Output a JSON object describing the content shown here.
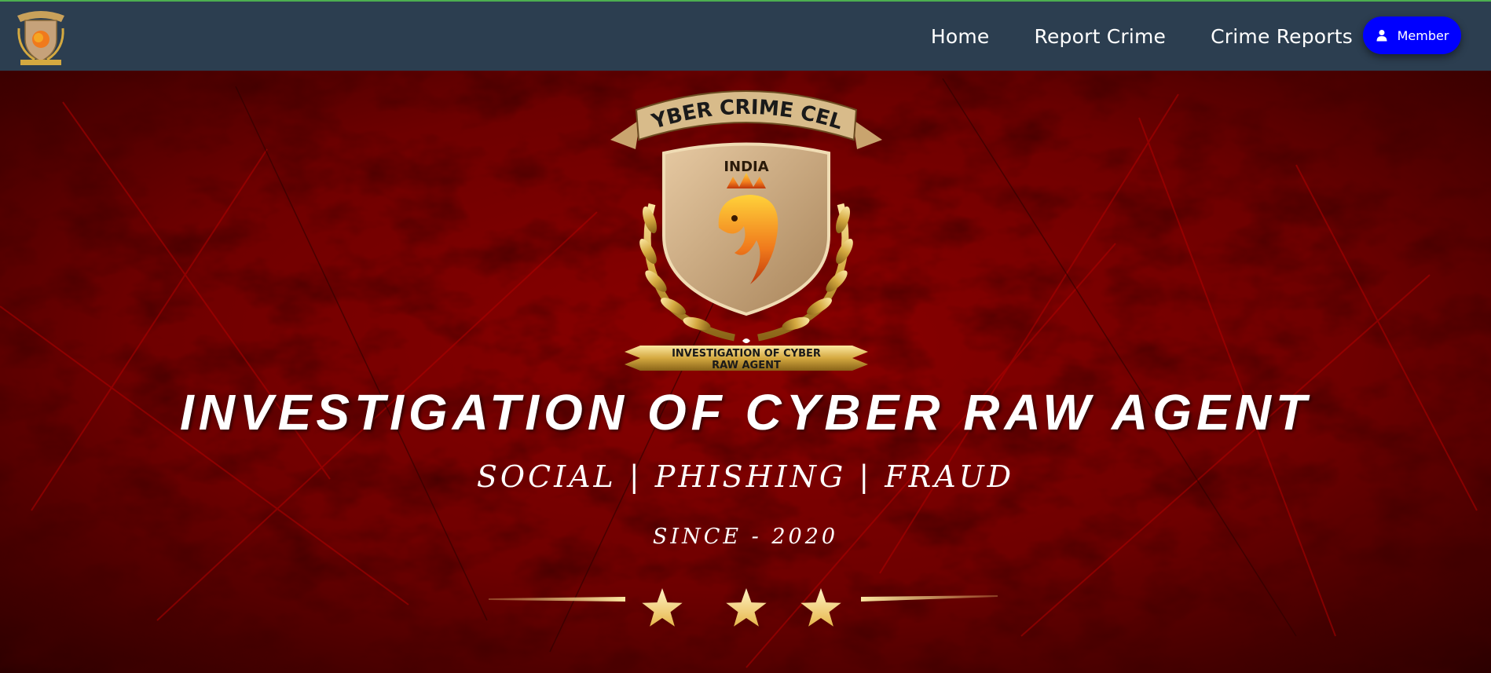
{
  "navbar": {
    "logo_icon": "cyber-crime-cell-badge",
    "links": [
      {
        "label": "Home"
      },
      {
        "label": "Report Crime"
      },
      {
        "label": "Crime Reports"
      }
    ],
    "member_button": {
      "label": "Member",
      "icon": "user-icon",
      "color": "#0000ff"
    },
    "background_color": "#2c3e50"
  },
  "hero": {
    "emblem": {
      "banner_text": "CYBER CRIME CELL",
      "shield_text": "INDIA",
      "ribbon_line1": "INVESTIGATION OF CYBER",
      "ribbon_line2": "RAW AGENT"
    },
    "title": "INVESTIGATION OF CYBER RAW AGENT",
    "subtitle": "SOCIAL | PHISHING | FRAUD",
    "since": "SINCE - 2020",
    "star_count": 3,
    "accent_color": "#f4d27a",
    "background_color": "#7a0000"
  }
}
